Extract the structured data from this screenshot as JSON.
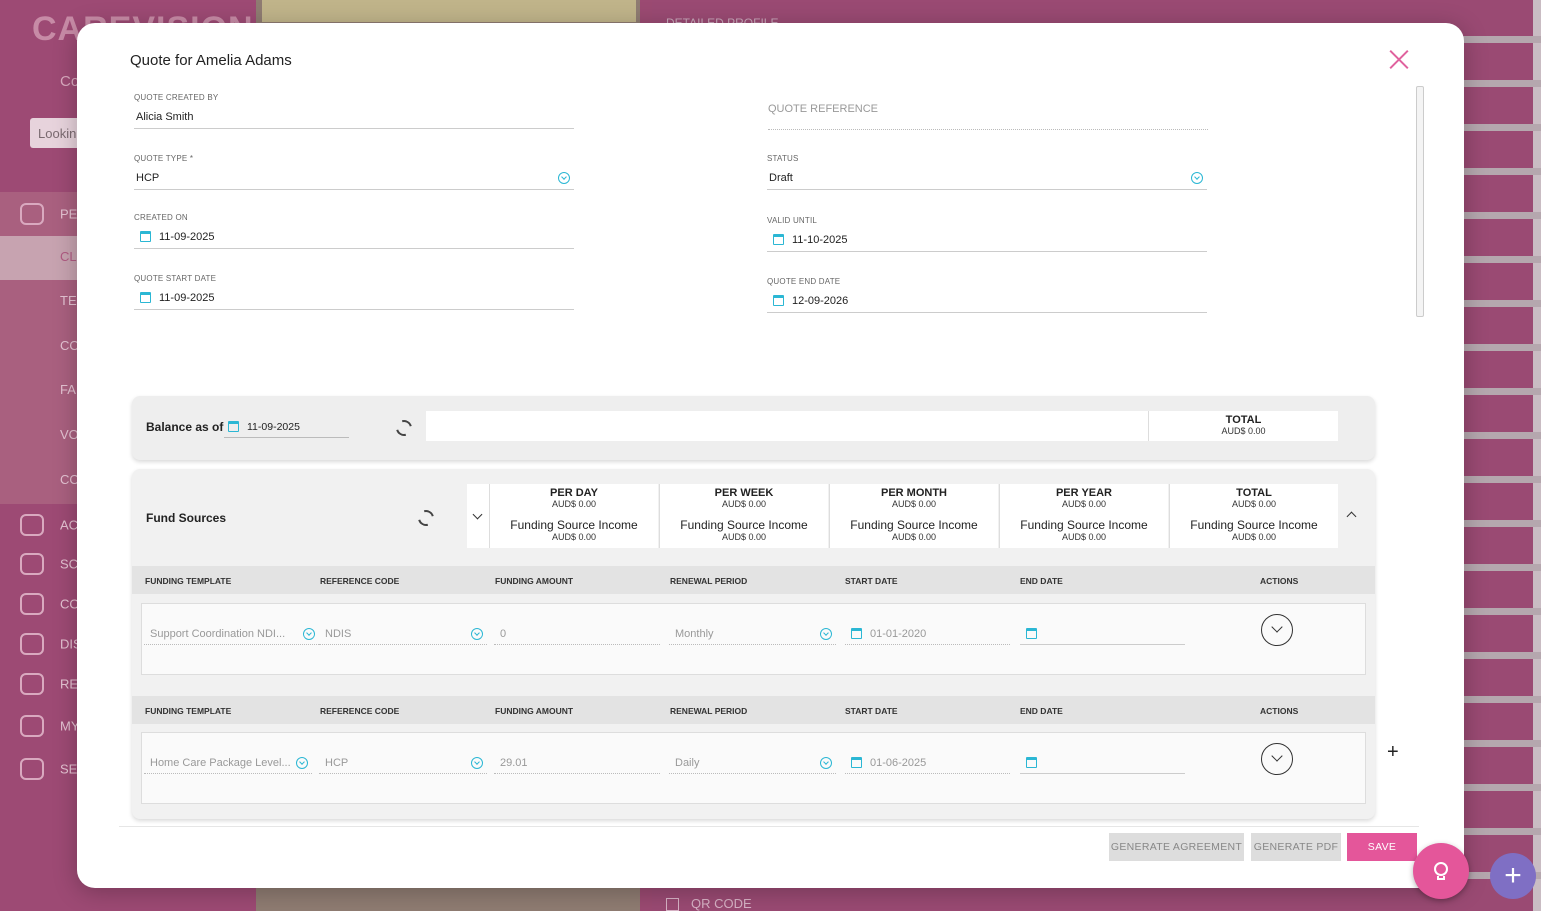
{
  "background": {
    "logo": "CAREVISION",
    "sub_label": "Co",
    "search_placeholder": "Lookin",
    "nav_items": [
      {
        "label": "PE",
        "icon": "people-icon",
        "top": 0
      },
      {
        "label": "CL",
        "icon": "",
        "top": 0
      },
      {
        "label": "TE",
        "icon": "",
        "top": 0
      },
      {
        "label": "CO",
        "icon": "",
        "top": 0
      },
      {
        "label": "FA",
        "icon": "",
        "top": 0
      },
      {
        "label": "VO",
        "icon": "",
        "top": 0
      },
      {
        "label": "CO",
        "icon": "",
        "top": 0
      },
      {
        "label": "AC",
        "icon": "alert-icon",
        "top": 0
      },
      {
        "label": "SC",
        "icon": "schedule-icon",
        "top": 0
      },
      {
        "label": "CO",
        "icon": "heart-icon",
        "top": 0
      },
      {
        "label": "DIS",
        "icon": "chat-icon",
        "top": 0
      },
      {
        "label": "RE",
        "icon": "report-icon",
        "top": 0
      },
      {
        "label": "MY",
        "icon": "user-icon",
        "top": 0
      },
      {
        "label": "SE",
        "icon": "gear-icon",
        "top": 0
      }
    ],
    "detail_label": "DETAILED PROFILE",
    "qr_label": "QR CODE"
  },
  "modal": {
    "title": "Quote for Amelia Adams",
    "left_fields": [
      {
        "label": "QUOTE CREATED BY",
        "value": "Alicia Smith",
        "type": "text"
      },
      {
        "label": "QUOTE TYPE *",
        "value": "HCP",
        "type": "select"
      },
      {
        "label": "CREATED ON",
        "value": "11-09-2025",
        "type": "date"
      },
      {
        "label": "QUOTE START DATE",
        "value": "11-09-2025",
        "type": "date"
      }
    ],
    "quote_reference_placeholder": "QUOTE REFERENCE",
    "right_fields": [
      {
        "label": "STATUS",
        "value": "Draft",
        "type": "select"
      },
      {
        "label": "VALID UNTIL",
        "value": "11-10-2025",
        "type": "date"
      },
      {
        "label": "QUOTE END DATE",
        "value": "12-09-2026",
        "type": "date"
      }
    ]
  },
  "balance": {
    "label": "Balance as of",
    "date": "11-09-2025",
    "total_title": "TOTAL",
    "total_value": "AUD$ 0.00"
  },
  "fund_sources": {
    "label": "Fund Sources",
    "periods": [
      {
        "title": "PER DAY",
        "value": "AUD$ 0.00",
        "income_label": "Funding Source Income",
        "income_value": "AUD$ 0.00"
      },
      {
        "title": "PER WEEK",
        "value": "AUD$ 0.00",
        "income_label": "Funding Source Income",
        "income_value": "AUD$ 0.00"
      },
      {
        "title": "PER MONTH",
        "value": "AUD$ 0.00",
        "income_label": "Funding Source Income",
        "income_value": "AUD$ 0.00"
      },
      {
        "title": "PER YEAR",
        "value": "AUD$ 0.00",
        "income_label": "Funding Source Income",
        "income_value": "AUD$ 0.00"
      },
      {
        "title": "TOTAL",
        "value": "AUD$ 0.00",
        "income_label": "Funding Source Income",
        "income_value": "AUD$ 0.00"
      }
    ],
    "columns": [
      "FUNDING TEMPLATE",
      "REFERENCE CODE",
      "FUNDING AMOUNT",
      "RENEWAL PERIOD",
      "START DATE",
      "END DATE",
      "ACTIONS"
    ],
    "rows": [
      {
        "template": "Support Coordination NDI...",
        "reference": "NDIS",
        "amount": "0",
        "renewal": "Monthly",
        "start": "01-01-2020",
        "end": ""
      },
      {
        "template": "Home Care Package Level...",
        "reference": "HCP",
        "amount": "29.01",
        "renewal": "Daily",
        "start": "01-06-2025",
        "end": ""
      }
    ]
  },
  "footer": {
    "generate_agreement": "GENERATE AGREEMENT",
    "generate_pdf": "GENERATE PDF",
    "save": "SAVE"
  },
  "colors": {
    "accent": "#e4569a",
    "icon_blue": "#2bb7d4",
    "background_magenta": "#9b4a72",
    "fab_purple": "#7f6fc4"
  }
}
